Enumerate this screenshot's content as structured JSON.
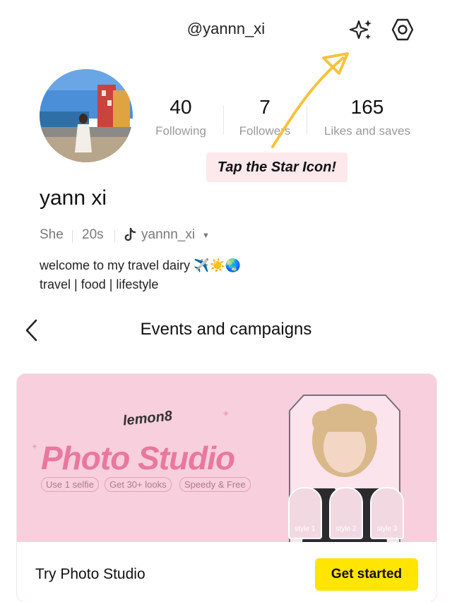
{
  "header": {
    "username": "@yannn_xi"
  },
  "stats": [
    {
      "value": "40",
      "label": "Following"
    },
    {
      "value": "7",
      "label": "Followers"
    },
    {
      "value": "165",
      "label": "Likes and saves"
    }
  ],
  "annotation": {
    "text": "Tap the Star Icon!",
    "color": "#f5c33b"
  },
  "profile": {
    "name": "yann xi",
    "pronoun": "She",
    "age": "20s",
    "tiktok_handle": "yannn_xi",
    "bio_line1": "welcome to my travel dairy ✈️☀️🌏",
    "bio_line2": "travel | food | lifestyle"
  },
  "events": {
    "title": "Events and campaigns",
    "card": {
      "brand": "lemon8",
      "title": "Photo Studio",
      "pills": [
        "Use 1 selfie",
        "Get 30+ looks",
        "Speedy & Free"
      ],
      "styles": [
        "style 1",
        "style 2",
        "style 3"
      ],
      "cta_text": "Try Photo Studio",
      "button_label": "Get started",
      "button_color": "#ffe500",
      "banner_color": "#f8cfdc"
    }
  }
}
